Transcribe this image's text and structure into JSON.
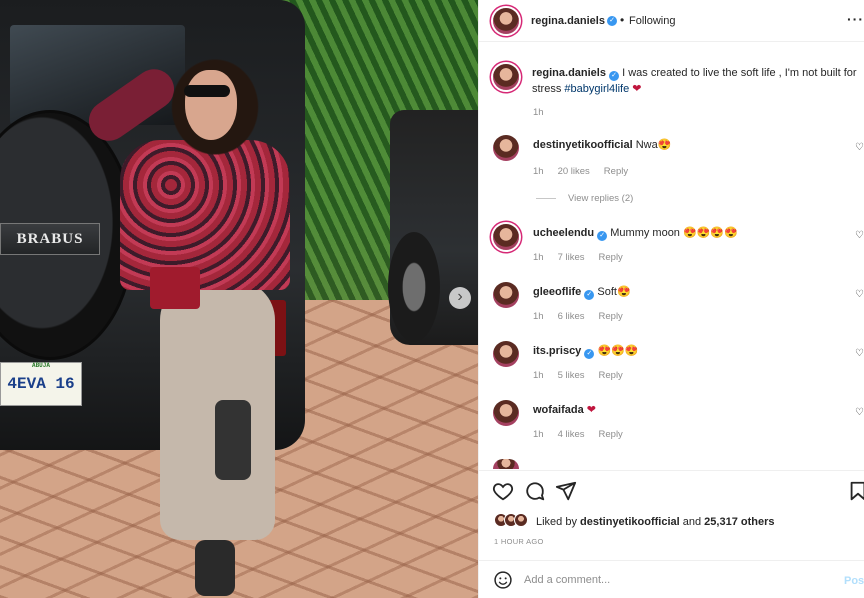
{
  "photo": {
    "brabus_badge": "BRABUS",
    "plate_text": "4EVA 16",
    "plate_state": "ABUJA"
  },
  "post": {
    "author": "regina.daniels",
    "follow_status": "Following",
    "caption_text": "I was created to live the soft life , I'm not built for stress",
    "caption_tag": "#babygirl4life",
    "caption_emoji": "❤",
    "caption_time": "1h"
  },
  "comments": [
    {
      "user": "destinyetikoofficial",
      "text": "Nwa",
      "emoji": "😍",
      "time": "1h",
      "likes": "20 likes",
      "reply": "Reply",
      "view_replies": "View replies (2)"
    },
    {
      "user": "ucheelendu",
      "text": "Mummy moon",
      "emoji": "😍😍😍😍",
      "time": "1h",
      "likes": "7 likes",
      "reply": "Reply",
      "verified": true
    },
    {
      "user": "gleeoflife",
      "text": "Soft",
      "emoji": "😍",
      "time": "1h",
      "likes": "6 likes",
      "reply": "Reply",
      "verified": true
    },
    {
      "user": "its.priscy",
      "text": "",
      "emoji": "😍😍😍",
      "time": "1h",
      "likes": "5 likes",
      "reply": "Reply",
      "verified": true
    },
    {
      "user": "wofaifada",
      "text": "",
      "emoji": "❤",
      "time": "1h",
      "likes": "4 likes",
      "reply": "Reply"
    }
  ],
  "actions": {
    "liked_by_prefix": "Liked by",
    "liked_by_user": "destinyetikoofficial",
    "liked_by_suffix": "and",
    "others": "25,317 others",
    "time_ago": "1 HOUR AGO"
  },
  "composer": {
    "placeholder": "Add a comment...",
    "post_label": "Post"
  },
  "colors": {
    "verified": "#3897f0",
    "hashtag": "#00376b",
    "post_button": "#b2dffc",
    "story_ring": "#d62976"
  }
}
